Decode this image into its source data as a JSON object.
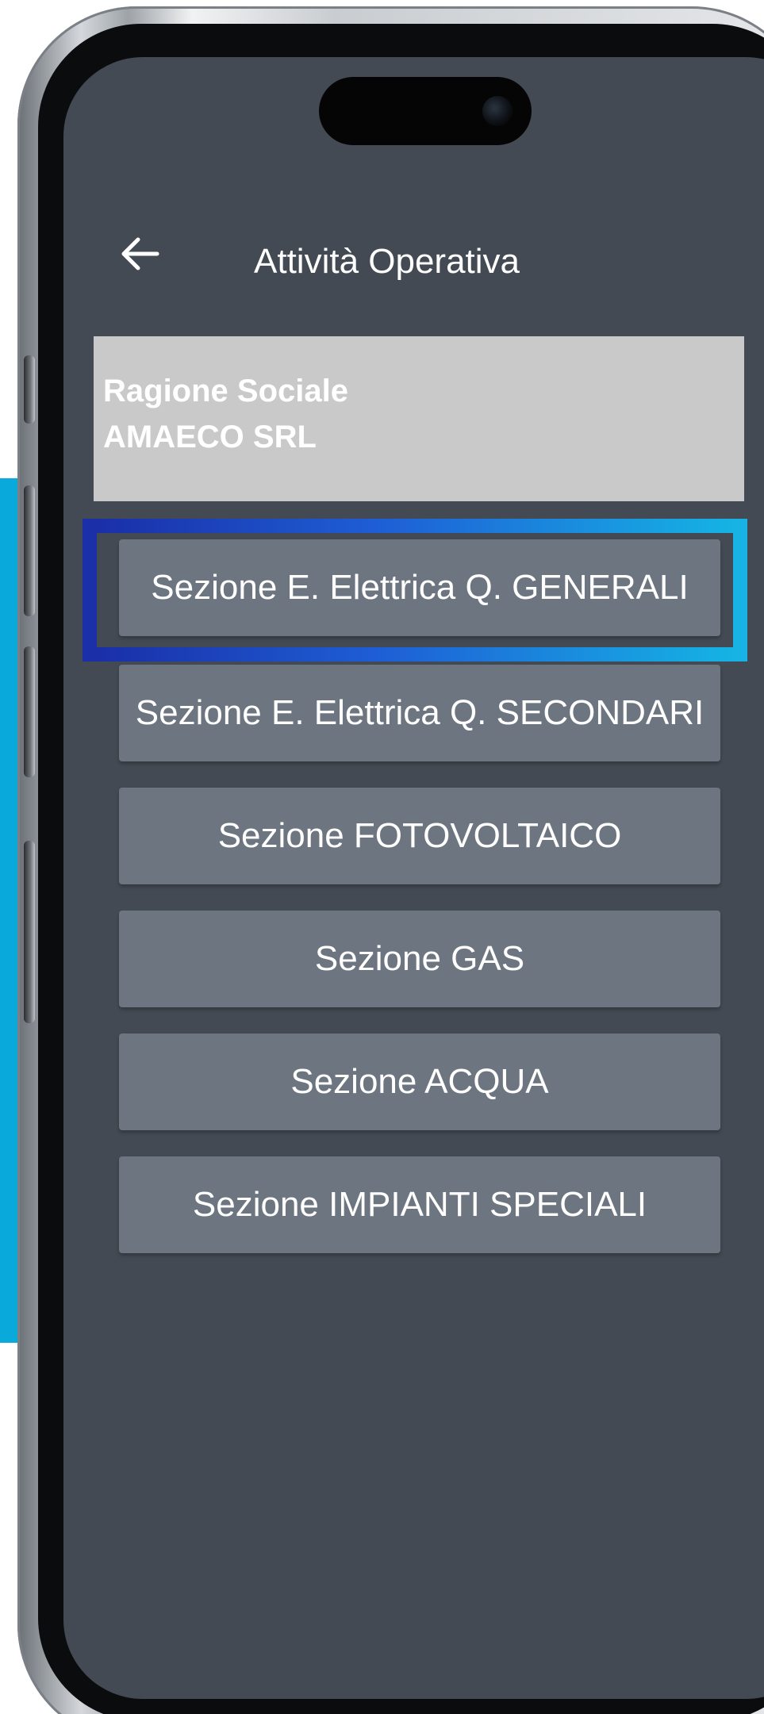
{
  "header": {
    "back_icon": "arrow-left-icon",
    "title": "Attività Operativa"
  },
  "company": {
    "label": "Ragione Sociale",
    "value": "AMAECO SRL"
  },
  "sections": [
    {
      "label": "Sezione E. Elettrica Q. GENERALI",
      "highlighted": true
    },
    {
      "label": "Sezione E. Elettrica Q. SECONDARI",
      "highlighted": false
    },
    {
      "label": "Sezione FOTOVOLTAICO",
      "highlighted": false
    },
    {
      "label": "Sezione GAS",
      "highlighted": false
    },
    {
      "label": "Sezione ACQUA",
      "highlighted": false
    },
    {
      "label": "Sezione IMPIANTI SPECIALI",
      "highlighted": false
    }
  ],
  "colors": {
    "screen_background": "#434a53",
    "button_background": "#6d7680",
    "company_box": "#c9c9c9",
    "highlight_start": "#1a2fa8",
    "highlight_end": "#16b3e4",
    "accent_bar": "#0aa9dc"
  }
}
